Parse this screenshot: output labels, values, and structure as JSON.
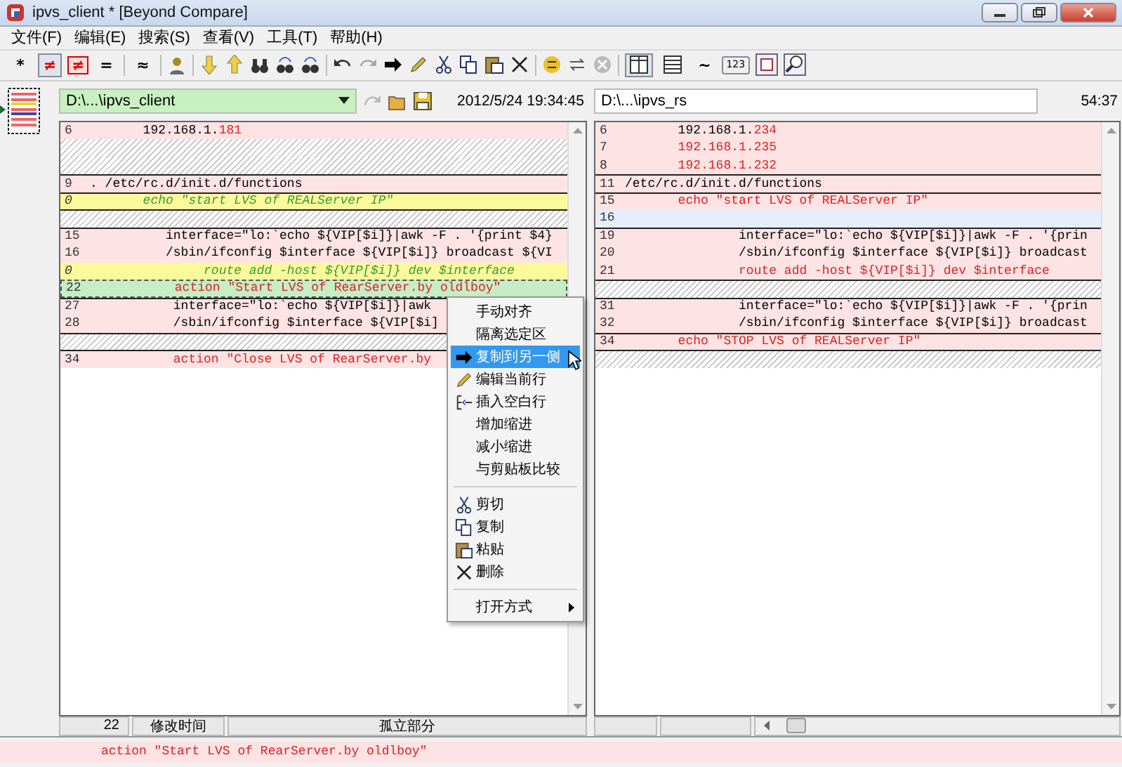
{
  "window": {
    "title": "ipvs_client *  [Beyond Compare]"
  },
  "menu": [
    "文件(F)",
    "编辑(E)",
    "搜索(S)",
    "查看(V)",
    "工具(T)",
    "帮助(H)"
  ],
  "toolbar": {
    "filters": [
      {
        "label": "*",
        "selected": false
      },
      {
        "label": "≠",
        "selected": true
      },
      {
        "label": "≠",
        "selected": false
      },
      {
        "label": "=",
        "selected": false
      }
    ],
    "similar": "≈",
    "layouts": [
      {
        "selected": true
      },
      {
        "selected": false
      }
    ],
    "tilde": "~",
    "digits": "123"
  },
  "panes": [
    {
      "path": "D:\\...\\ipvs_client",
      "highlighted": true,
      "timestamp": "2012/5/24 19:34:45",
      "rows": [
        {
          "kind": "diff",
          "number": "6",
          "divider_above": false,
          "segments": [
            {
              "text": "       192.168.1.",
              "changed": false
            },
            {
              "text": "181",
              "changed": true
            }
          ]
        },
        {
          "kind": "gap",
          "divider_above": false
        },
        {
          "kind": "gap",
          "divider_above": false
        },
        {
          "kind": "diff",
          "number": "9",
          "divider_above": true,
          "segments": [
            {
              "text": ". /etc/rc.d/init.d/functions",
              "changed": false
            }
          ]
        },
        {
          "kind": "orphan",
          "number": "0",
          "divider_above": true,
          "segments": [
            {
              "text": "       echo \"start LVS of REALServer IP\"",
              "changed": false
            }
          ]
        },
        {
          "kind": "gap",
          "divider_above": true
        },
        {
          "kind": "diff",
          "number": "15",
          "divider_above": true,
          "segments": [
            {
              "text": "          interface=\"lo:`echo ${VIP[$i]}|awk -F . '{print $4}",
              "changed": false
            }
          ]
        },
        {
          "kind": "diff",
          "number": "16",
          "divider_above": false,
          "segments": [
            {
              "text": "          /sbin/ifconfig $interface ${VIP[$i]} broadcast ${VI",
              "changed": false
            }
          ]
        },
        {
          "kind": "orphan",
          "number": "0",
          "divider_above": false,
          "segments": [
            {
              "text": "               route add -host ${VIP[$i]} dev $interface",
              "changed": false
            }
          ]
        },
        {
          "kind": "current",
          "number": "22",
          "divider_above": true,
          "segments": [
            {
              "text": "           action \"Start LVS of RearServer.by oldlboy\"",
              "changed": true
            }
          ]
        },
        {
          "kind": "diff",
          "number": "27",
          "divider_above": true,
          "segments": [
            {
              "text": "           interface=\"lo:`echo ${VIP[$i]}|awk",
              "changed": false
            }
          ]
        },
        {
          "kind": "diff",
          "number": "28",
          "divider_above": false,
          "segments": [
            {
              "text": "           /sbin/ifconfig $interface ${VIP[$i]",
              "changed": false
            }
          ]
        },
        {
          "kind": "gap",
          "divider_above": true
        },
        {
          "kind": "diff",
          "number": "34",
          "divider_above": true,
          "segments": [
            {
              "text": "           action \"Close LVS of RearServer.by",
              "changed": true
            }
          ]
        }
      ],
      "status": [
        "22",
        "修改时间",
        "孤立部分"
      ]
    },
    {
      "path": "D:\\...\\ipvs_rs",
      "highlighted": false,
      "timestamp": "54:37",
      "rows": [
        {
          "kind": "diff",
          "number": "6",
          "divider_above": false,
          "segments": [
            {
              "text": "       192.168.1.",
              "changed": false
            },
            {
              "text": "234",
              "changed": true
            }
          ]
        },
        {
          "kind": "diff",
          "number": "7",
          "divider_above": false,
          "segments": [
            {
              "text": "       192.168.1.235",
              "changed": true
            }
          ]
        },
        {
          "kind": "diff",
          "number": "8",
          "divider_above": false,
          "segments": [
            {
              "text": "       192.168.1.232",
              "changed": true
            }
          ]
        },
        {
          "kind": "diff",
          "number": "11",
          "divider_above": true,
          "segments": [
            {
              "text": "/etc/rc.d/init.d/functions",
              "changed": false
            }
          ]
        },
        {
          "kind": "diff",
          "number": "15",
          "divider_above": true,
          "segments": [
            {
              "text": "       echo \"start LVS of REALServer IP\"",
              "changed": true
            }
          ]
        },
        {
          "kind": "blank",
          "number": "16",
          "divider_above": false,
          "segments": []
        },
        {
          "kind": "diff",
          "number": "19",
          "divider_above": true,
          "segments": [
            {
              "text": "               interface=\"lo:`echo ${VIP[$i]}|awk -F . '{prin",
              "changed": false
            }
          ]
        },
        {
          "kind": "diff",
          "number": "20",
          "divider_above": false,
          "segments": [
            {
              "text": "               /sbin/ifconfig $interface ${VIP[$i]} broadcast",
              "changed": false
            }
          ]
        },
        {
          "kind": "diff",
          "number": "21",
          "divider_above": false,
          "segments": [
            {
              "text": "               route add -host ${VIP[$i]} dev $interface",
              "changed": true
            }
          ]
        },
        {
          "kind": "gap",
          "divider_above": true
        },
        {
          "kind": "diff",
          "number": "31",
          "divider_above": true,
          "segments": [
            {
              "text": "               interface=\"lo:`echo ${VIP[$i]}|awk -F . '{prin",
              "changed": false
            }
          ]
        },
        {
          "kind": "diff",
          "number": "32",
          "divider_above": false,
          "segments": [
            {
              "text": "               /sbin/ifconfig $interface ${VIP[$i]} broadcast",
              "changed": false
            }
          ]
        },
        {
          "kind": "diff",
          "number": "34",
          "divider_above": true,
          "segments": [
            {
              "text": "       echo \"STOP LVS of REALServer IP\"",
              "changed": true
            }
          ]
        },
        {
          "kind": "gap",
          "divider_above": true
        }
      ]
    }
  ],
  "context_menu": [
    {
      "kind": "item",
      "label": "手动对齐",
      "selected": false,
      "submenu": false
    },
    {
      "kind": "item",
      "label": "隔离选定区",
      "selected": false,
      "submenu": false
    },
    {
      "kind": "item",
      "label": "复制到另一侧",
      "selected": true,
      "submenu": false
    },
    {
      "kind": "item",
      "label": "编辑当前行",
      "selected": false,
      "submenu": false
    },
    {
      "kind": "item",
      "label": "插入空白行",
      "selected": false,
      "submenu": false
    },
    {
      "kind": "item",
      "label": "增加缩进",
      "selected": false,
      "submenu": false
    },
    {
      "kind": "item",
      "label": "减小缩进",
      "selected": false,
      "submenu": false
    },
    {
      "kind": "item",
      "label": "与剪贴板比较",
      "selected": false,
      "submenu": false
    },
    {
      "kind": "separator"
    },
    {
      "kind": "item",
      "label": "剪切",
      "selected": false,
      "submenu": false
    },
    {
      "kind": "item",
      "label": "复制",
      "selected": false,
      "submenu": false
    },
    {
      "kind": "item",
      "label": "粘贴",
      "selected": false,
      "submenu": false
    },
    {
      "kind": "item",
      "label": "删除",
      "selected": false,
      "submenu": false
    },
    {
      "kind": "separator"
    },
    {
      "kind": "item",
      "label": "打开方式",
      "selected": false,
      "submenu": true
    }
  ],
  "current_line": {
    "text": "action \"Start LVS of RearServer.by oldlboy\""
  }
}
